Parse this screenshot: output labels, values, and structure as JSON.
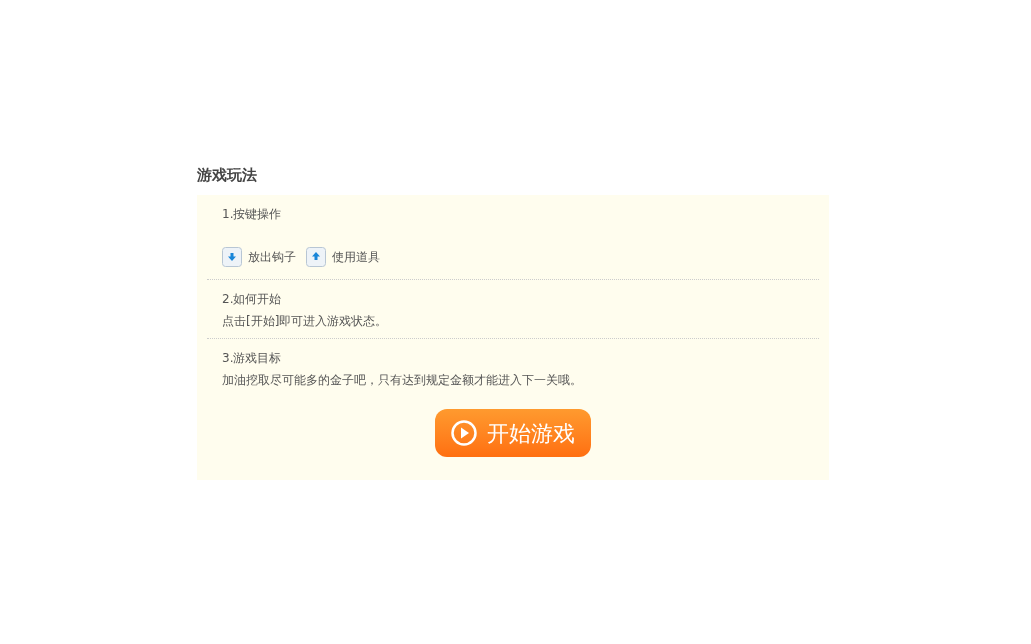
{
  "title": "游戏玩法",
  "sections": [
    {
      "heading": "1.按键操作",
      "keys": [
        {
          "kind": "down",
          "label": "放出钩子"
        },
        {
          "kind": "up",
          "label": "使用道具"
        }
      ]
    },
    {
      "heading": "2.如何开始",
      "text": "点击[开始]即可进入游戏状态。"
    },
    {
      "heading": "3.游戏目标",
      "text": "加油挖取尽可能多的金子吧，只有达到规定金额才能进入下一关哦。"
    }
  ],
  "button": "开始游戏"
}
